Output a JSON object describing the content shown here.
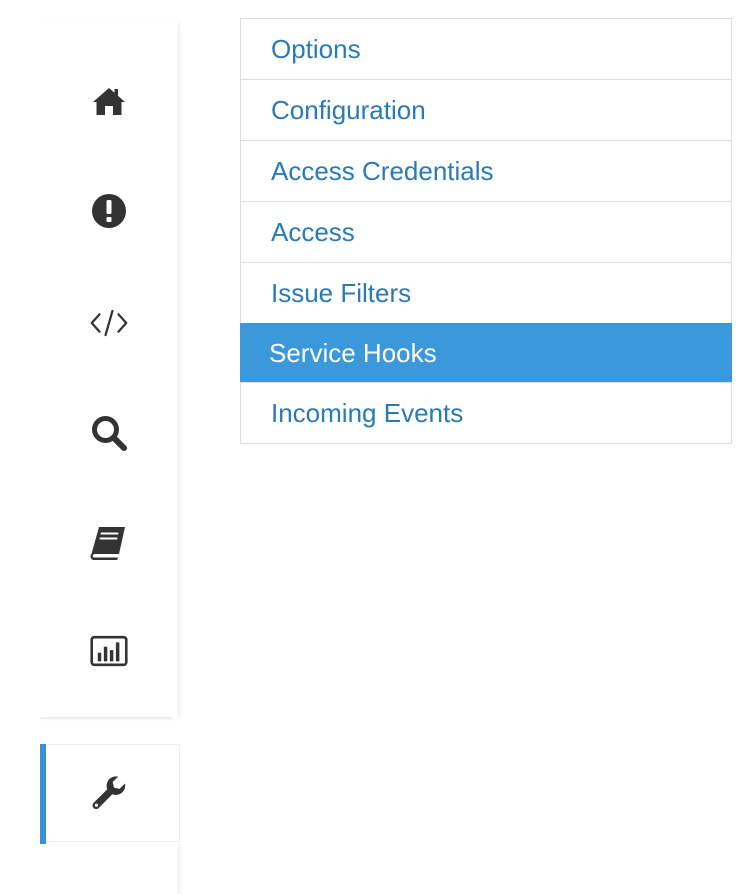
{
  "colors": {
    "link": "#2a7ab8",
    "active_bg": "#3a98db",
    "active_text": "#ffffff",
    "icon": "#333333",
    "accent": "#3a8fd6",
    "border": "#dddddd"
  },
  "sidebar": {
    "icons": [
      {
        "name": "home-icon"
      },
      {
        "name": "exclamation-circle-icon"
      },
      {
        "name": "code-icon"
      },
      {
        "name": "search-icon"
      },
      {
        "name": "book-icon"
      },
      {
        "name": "bar-chart-icon"
      }
    ],
    "active_icon": "wrench-icon"
  },
  "menu": {
    "items": [
      {
        "label": "Options",
        "active": false
      },
      {
        "label": "Configuration",
        "active": false
      },
      {
        "label": "Access Credentials",
        "active": false
      },
      {
        "label": "Access",
        "active": false
      },
      {
        "label": "Issue Filters",
        "active": false
      },
      {
        "label": "Service Hooks",
        "active": true
      },
      {
        "label": "Incoming Events",
        "active": false
      }
    ]
  }
}
